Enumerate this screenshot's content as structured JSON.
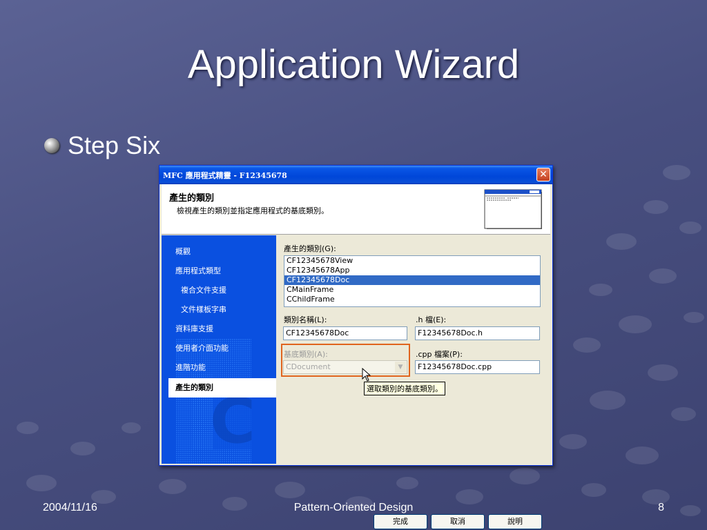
{
  "slide": {
    "title": "Application Wizard",
    "bullet": "Step Six",
    "footer_date": "2004/11/16",
    "footer_center": "Pattern-Oriented Design",
    "footer_page": "8"
  },
  "dialog": {
    "window_title": "MFC 應用程式精靈 - F12345678",
    "close_symbol": "✕",
    "header_title": "產生的類別",
    "header_subtitle": "檢視產生的類別並指定應用程式的基底類別。",
    "sidebar": {
      "items": [
        {
          "label": "概觀"
        },
        {
          "label": "應用程式類型"
        },
        {
          "label": "複合文件支援"
        },
        {
          "label": "文件樣板字串"
        },
        {
          "label": "資料庫支援"
        },
        {
          "label": "使用者介面功能"
        },
        {
          "label": "進階功能"
        },
        {
          "label": "產生的類別"
        }
      ],
      "active_index": 7
    },
    "generated_classes_label": "產生的類別(G):",
    "classes": [
      "CF12345678View",
      "CF12345678App",
      "CF12345678Doc",
      "CMainFrame",
      "CChildFrame"
    ],
    "selected_class": "CF12345678Doc",
    "class_name_label": "類別名稱(L):",
    "class_name_value": "CF12345678Doc",
    "h_file_label": ".h 檔(E):",
    "h_file_value": "F12345678Doc.h",
    "base_class_label": "基底類別(A):",
    "base_class_value": "CDocument",
    "cpp_file_label": ".cpp 檔案(P):",
    "cpp_file_value": "F12345678Doc.cpp",
    "tooltip": "選取類別的基底類別。",
    "buttons": {
      "finish": "完成",
      "cancel": "取消",
      "help": "說明"
    }
  },
  "colors": {
    "background": "#4a5182",
    "titlebar": "#0046d8",
    "sidebar": "#0a50e0",
    "selection": "#316ac5",
    "highlight_box": "#e0641e"
  }
}
